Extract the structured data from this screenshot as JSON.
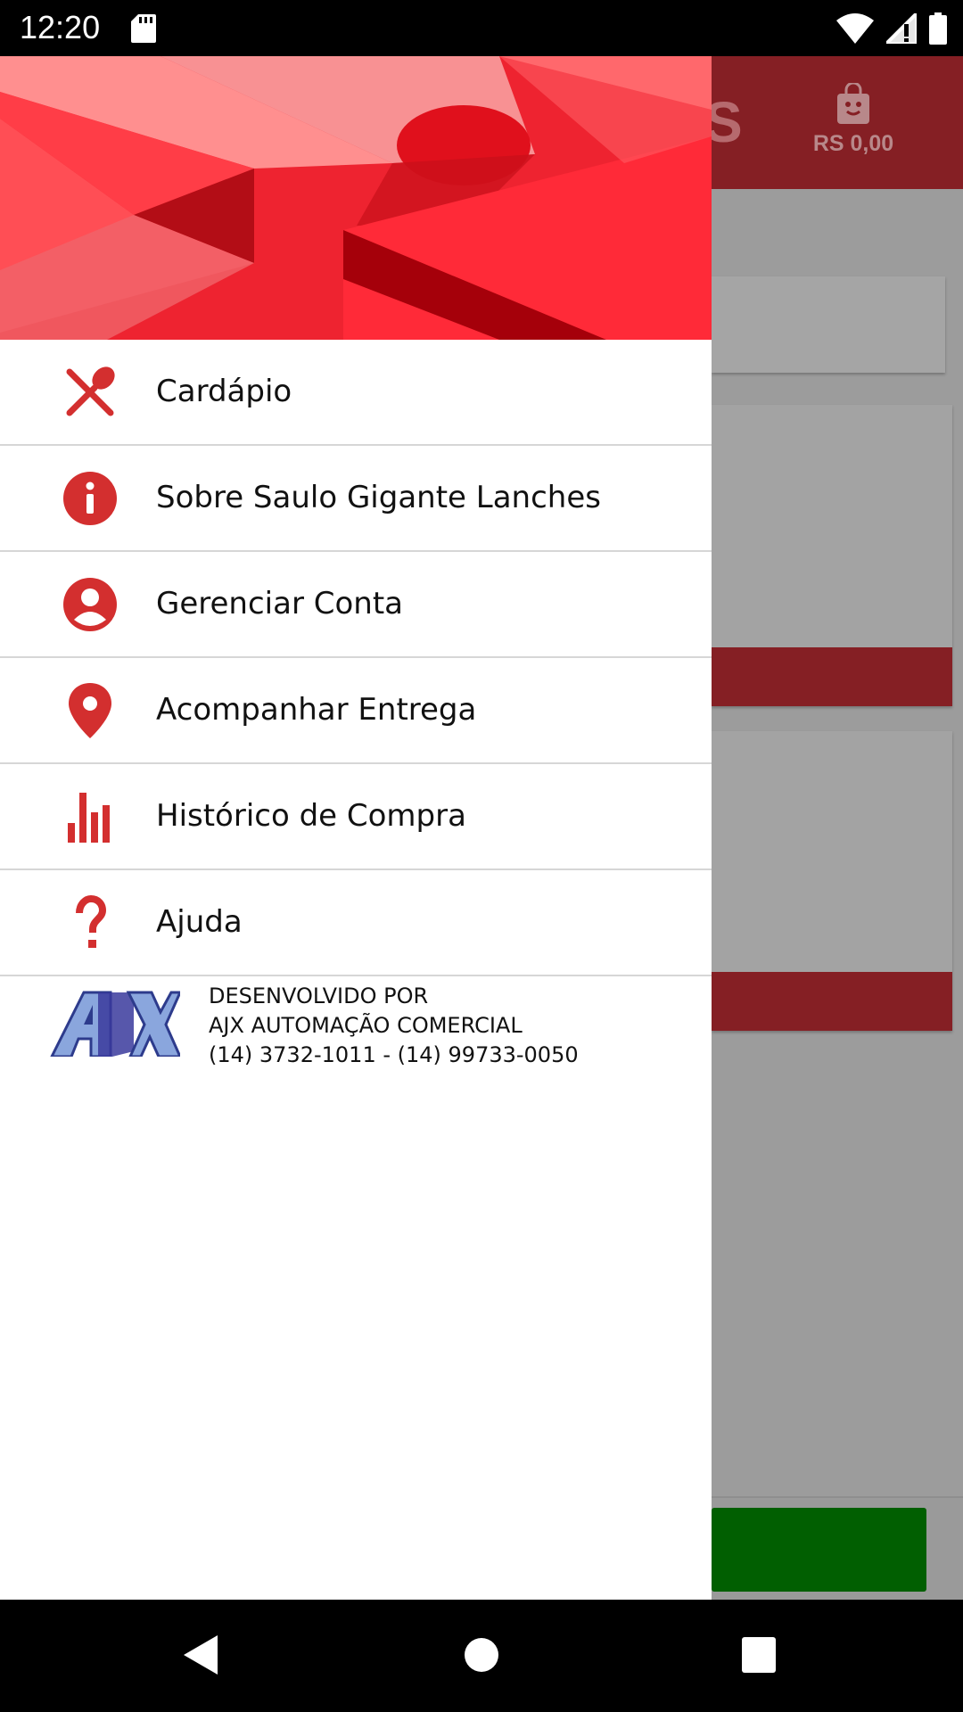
{
  "status_bar": {
    "time": "12:20",
    "icons": [
      "sd-card-icon",
      "wifi-icon",
      "signal-icon",
      "battery-icon"
    ]
  },
  "background_app": {
    "cart_total": "RS 0,00",
    "logo_fragment": "S",
    "colors": {
      "toolbar": "#851f24",
      "checkout_button": "#015f01"
    }
  },
  "drawer": {
    "menu": [
      {
        "label": "Cardápio",
        "icon": "fork-spoon-icon"
      },
      {
        "label": "Sobre Saulo Gigante Lanches",
        "icon": "info-icon"
      },
      {
        "label": "Gerenciar Conta",
        "icon": "account-circle-icon"
      },
      {
        "label": "Acompanhar Entrega",
        "icon": "location-pin-icon"
      },
      {
        "label": "Histórico de Compra",
        "icon": "bar-chart-icon"
      },
      {
        "label": "Ajuda",
        "icon": "question-mark-icon"
      }
    ],
    "credit": {
      "line1": "DESENVOLVIDO POR",
      "line2": "AJX AUTOMAÇÃO COMERCIAL",
      "line3": "(14) 3732-1011 - (14) 99733-0050",
      "logo_text": "AJX"
    },
    "colors": {
      "accent": "#d32f2f",
      "header": "#ee2330"
    }
  },
  "nav_bar": {
    "buttons": [
      "back-icon",
      "home-icon",
      "recents-icon"
    ]
  }
}
